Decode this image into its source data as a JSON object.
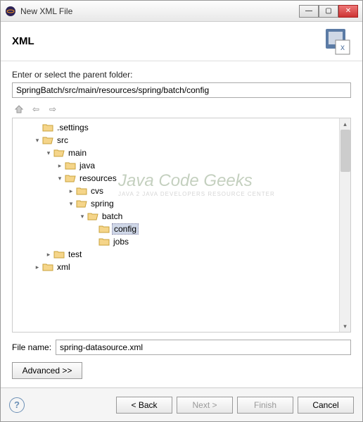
{
  "window": {
    "title": "New XML File"
  },
  "banner": {
    "heading": "XML"
  },
  "parentFolder": {
    "label": "Enter or select the parent folder:",
    "value": "SpringBatch/src/main/resources/spring/batch/config"
  },
  "tree": [
    {
      "level": 1,
      "expander": "",
      "icon": "folder",
      "label": ".settings"
    },
    {
      "level": 1,
      "expander": "▾",
      "icon": "folder-open",
      "label": "src"
    },
    {
      "level": 2,
      "expander": "▾",
      "icon": "folder-open",
      "label": "main"
    },
    {
      "level": 3,
      "expander": "▸",
      "icon": "folder",
      "label": "java"
    },
    {
      "level": 3,
      "expander": "▾",
      "icon": "folder-open",
      "label": "resources"
    },
    {
      "level": 4,
      "expander": "▸",
      "icon": "folder",
      "label": "cvs"
    },
    {
      "level": 4,
      "expander": "▾",
      "icon": "folder-open",
      "label": "spring"
    },
    {
      "level": 5,
      "expander": "▾",
      "icon": "folder-open",
      "label": "batch"
    },
    {
      "level": 6,
      "expander": "",
      "icon": "folder",
      "label": "config",
      "selected": true
    },
    {
      "level": 6,
      "expander": "",
      "icon": "folder",
      "label": "jobs"
    },
    {
      "level": 2,
      "expander": "▸",
      "icon": "folder",
      "label": "test"
    },
    {
      "level": 1,
      "expander": "▸",
      "icon": "folder",
      "label": "xml"
    }
  ],
  "fileName": {
    "label": "File name:",
    "value": "spring-datasource.xml"
  },
  "advanced": {
    "label": "Advanced >>"
  },
  "buttons": {
    "back": "< Back",
    "next": "Next >",
    "finish": "Finish",
    "cancel": "Cancel"
  },
  "watermark": {
    "main": "Java Code Geeks",
    "sub": "JAVA 2 JAVA DEVELOPERS RESOURCE CENTER"
  }
}
